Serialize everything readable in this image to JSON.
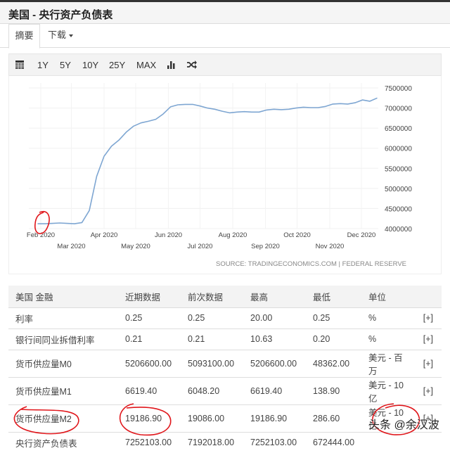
{
  "header": {
    "title": "美国 - 央行资产负债表"
  },
  "tabs": [
    {
      "label": "摘要",
      "active": true
    },
    {
      "label": "下载"
    }
  ],
  "toolbar": {
    "calendar_icon": "calendar-icon",
    "ranges": [
      "1Y",
      "5Y",
      "10Y",
      "25Y",
      "MAX"
    ],
    "chart_type_icon": "bar-chart-icon",
    "compare_icon": "shuffle-icon"
  },
  "chart_data": {
    "type": "line",
    "source": "SOURCE: TRADINGECONOMICS.COM | FEDERAL RESERVE",
    "line_color": "#7ea6d2",
    "grid": true,
    "ylim": [
      4000000,
      7500000
    ],
    "y_ticks": [
      "7500000",
      "7000000",
      "6500000",
      "6000000",
      "5500000",
      "5000000",
      "4500000",
      "4000000"
    ],
    "x_ticks": [
      "Feb 2020",
      "Mar 2020",
      "Apr 2020",
      "May 2020",
      "Jun 2020",
      "Jul 2020",
      "Aug 2020",
      "Sep 2020",
      "Oct 2020",
      "Nov 2020",
      "Dec 2020"
    ],
    "x": [
      "2020-01-29",
      "2020-02-05",
      "2020-02-12",
      "2020-02-19",
      "2020-02-26",
      "2020-03-04",
      "2020-03-11",
      "2020-03-18",
      "2020-03-25",
      "2020-04-01",
      "2020-04-08",
      "2020-04-15",
      "2020-04-22",
      "2020-04-29",
      "2020-05-06",
      "2020-05-13",
      "2020-05-20",
      "2020-05-27",
      "2020-06-03",
      "2020-06-10",
      "2020-06-17",
      "2020-06-24",
      "2020-07-01",
      "2020-07-08",
      "2020-07-15",
      "2020-07-22",
      "2020-07-29",
      "2020-08-05",
      "2020-08-12",
      "2020-08-19",
      "2020-08-26",
      "2020-09-02",
      "2020-09-09",
      "2020-09-16",
      "2020-09-23",
      "2020-09-30",
      "2020-10-07",
      "2020-10-14",
      "2020-10-21",
      "2020-10-28",
      "2020-11-04",
      "2020-11-11",
      "2020-11-18",
      "2020-11-25",
      "2020-12-02",
      "2020-12-09",
      "2020-12-16"
    ],
    "values": [
      4120000,
      4120000,
      4130000,
      4140000,
      4130000,
      4120000,
      4150000,
      4450000,
      5300000,
      5800000,
      6050000,
      6200000,
      6400000,
      6550000,
      6630000,
      6670000,
      6720000,
      6850000,
      7030000,
      7080000,
      7090000,
      7090000,
      7050000,
      7000000,
      6970000,
      6920000,
      6880000,
      6900000,
      6910000,
      6900000,
      6900000,
      6950000,
      6970000,
      6960000,
      6970000,
      7000000,
      7020000,
      7010000,
      7010000,
      7040000,
      7100000,
      7110000,
      7100000,
      7130000,
      7200000,
      7170000,
      7250000
    ]
  },
  "table": {
    "headers": [
      "美国 金融",
      "近期数据",
      "前次数据",
      "最高",
      "最低",
      "单位",
      ""
    ],
    "rows": [
      [
        "利率",
        "0.25",
        "0.25",
        "20.00",
        "0.25",
        "%",
        "[+]"
      ],
      [
        "银行间同业拆借利率",
        "0.21",
        "0.21",
        "10.63",
        "0.20",
        "%",
        "[+]"
      ],
      [
        "货币供应量M0",
        "5206600.00",
        "5093100.00",
        "5206600.00",
        "48362.00",
        "美元 - 百万",
        "[+]"
      ],
      [
        "货币供应量M1",
        "6619.40",
        "6048.20",
        "6619.40",
        "138.90",
        "美元 - 10亿",
        "[+]"
      ],
      [
        "货币供应量M2",
        "19186.90",
        "19086.00",
        "19186.90",
        "286.60",
        "美元 - 10亿",
        "[+]"
      ],
      [
        "央行资产负债表",
        "7252103.00",
        "7192018.00",
        "7252103.00",
        "672444.00",
        "",
        ""
      ]
    ]
  },
  "annotation_color": "#e0161b",
  "watermark": "头条 @余汉波"
}
